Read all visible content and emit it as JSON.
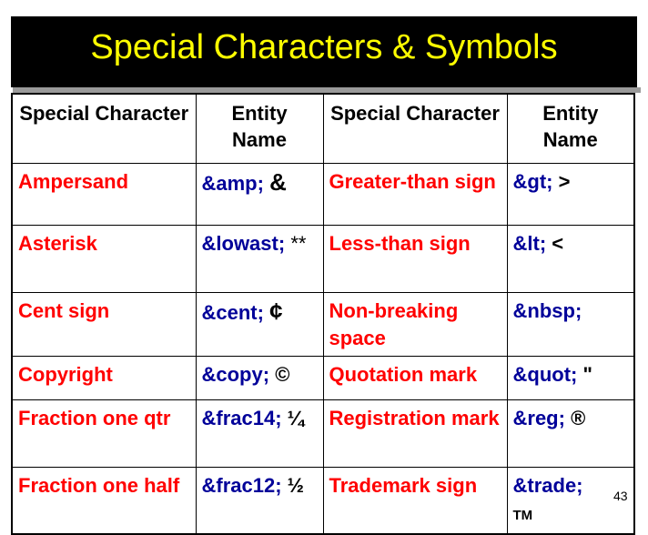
{
  "title": "Special Characters & Symbols",
  "headers": [
    "Special Character",
    "Entity Name",
    "Special Character",
    "Entity Name"
  ],
  "rows": [
    {
      "left_name": "Ampersand",
      "left_entity": "&amp;",
      "left_symbol": "&",
      "right_name": "Greater-than sign",
      "right_entity": "&gt;",
      "right_symbol": ">"
    },
    {
      "left_name": "Asterisk",
      "left_entity": "&lowast;",
      "left_symbol": "**",
      "right_name": "Less-than sign",
      "right_entity": "&lt;",
      "right_symbol": "<"
    },
    {
      "left_name": "Cent sign",
      "left_entity": "&cent;",
      "left_symbol": "¢",
      "right_name": "Non-breaking space",
      "right_entity": "&nbsp;",
      "right_symbol": ""
    },
    {
      "left_name": "Copyright",
      "left_entity": "&copy;",
      "left_symbol": "©",
      "right_name": "Quotation mark",
      "right_entity": "&quot;",
      "right_symbol": "\""
    },
    {
      "left_name": "Fraction one qtr",
      "left_entity": "&frac14;",
      "left_symbol": "¼",
      "right_name": "Registration mark",
      "right_entity": "&reg;",
      "right_symbol": "®"
    },
    {
      "left_name": "Fraction one half",
      "left_entity": "&frac12;",
      "left_symbol": "½",
      "right_name": "Trademark sign",
      "right_entity": "&trade;",
      "right_symbol": "TM"
    }
  ],
  "page_number": "43",
  "colors": {
    "title_bg": "#000000",
    "title_text": "#ffff00",
    "name_text": "#ff0000",
    "entity_text": "#000099"
  }
}
